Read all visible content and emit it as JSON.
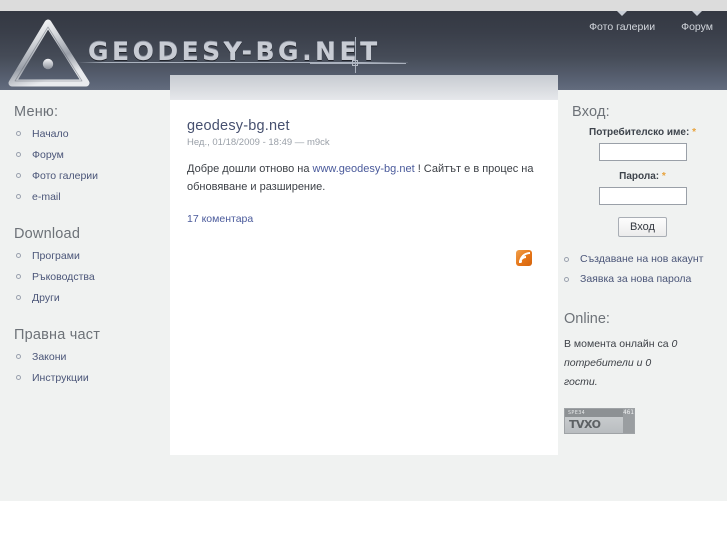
{
  "site": {
    "wordmark": "GEODESY-BG.NET",
    "logo_icon": "survey-triangle-icon"
  },
  "topmenu": {
    "items": [
      {
        "label": "Фото галерии"
      },
      {
        "label": "Форум"
      }
    ]
  },
  "sidebar_left": {
    "blocks": [
      {
        "title": "Меню:",
        "items": [
          {
            "label": "Начало"
          },
          {
            "label": "Форум"
          },
          {
            "label": "Фото галерии"
          },
          {
            "label": "e-mail"
          }
        ]
      },
      {
        "title": "Download",
        "items": [
          {
            "label": "Програми"
          },
          {
            "label": "Ръководства"
          },
          {
            "label": "Други"
          }
        ]
      },
      {
        "title": "Правна част",
        "items": [
          {
            "label": "Закони"
          },
          {
            "label": "Инструкции"
          }
        ]
      }
    ]
  },
  "content": {
    "node_title": "geodesy-bg.net",
    "node_meta": "Нед., 01/18/2009 - 18:49 — m9ck",
    "body_part1": "Добре дошли отново на ",
    "body_link": "www.geodesy-bg.net",
    "body_part2": " ! Сайтът е в процес на обновяване и разширение.",
    "comments_label": "17 коментара",
    "feed_icon": "rss-feed-icon"
  },
  "login": {
    "title": "Вход:",
    "username_label": "Потребителско име:",
    "username_required": "*",
    "username_value": "",
    "password_label": "Парола:",
    "password_required": "*",
    "password_value": "",
    "submit_label": "Вход",
    "links": [
      {
        "label": "Създаване на нов акаунт"
      },
      {
        "label": "Заявка за нова парола"
      }
    ]
  },
  "online": {
    "title": "Online:",
    "text_part1": "В момента онлайн са ",
    "users_count": "0",
    "text_part2": " потребители и ",
    "guests_count": "0",
    "text_part3": " гости."
  },
  "counter": {
    "top_label": "SPE34",
    "brand": "TVXO",
    "digits": "461"
  },
  "colors": {
    "header_dark": "#343842",
    "header_light": "#636c7e",
    "link": "#4a5578",
    "accent_orange": "#e57518",
    "page_bg": "#f0f2f1",
    "panel": "#ffffff"
  }
}
